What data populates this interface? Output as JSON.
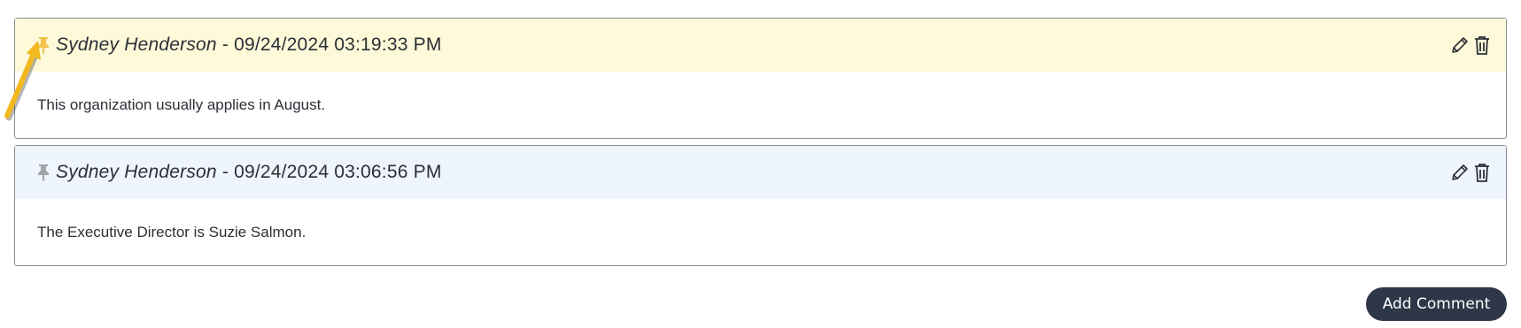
{
  "comments": [
    {
      "pinned": true,
      "author": "Sydney Henderson",
      "separator": " - ",
      "timestamp": "09/24/2024 03:19:33 PM",
      "text": "This organization usually applies in August.",
      "pin_color": "#f2c14e",
      "header_bg": "#fdf9d9"
    },
    {
      "pinned": false,
      "author": "Sydney Henderson",
      "separator": " - ",
      "timestamp": "09/24/2024 03:06:56 PM",
      "text": "The Executive Director is Suzie Salmon.",
      "pin_color": "#a0a3a8",
      "header_bg": "#eff5fd"
    }
  ],
  "icons": {
    "pin": "pushpin-icon",
    "edit": "pencil-icon",
    "delete": "trash-icon",
    "annotation": "arrow-annotation"
  },
  "add_comment_label": "Add Comment",
  "accent_colors": {
    "button_bg": "#2d3748",
    "arrow": "#f2b81f"
  }
}
